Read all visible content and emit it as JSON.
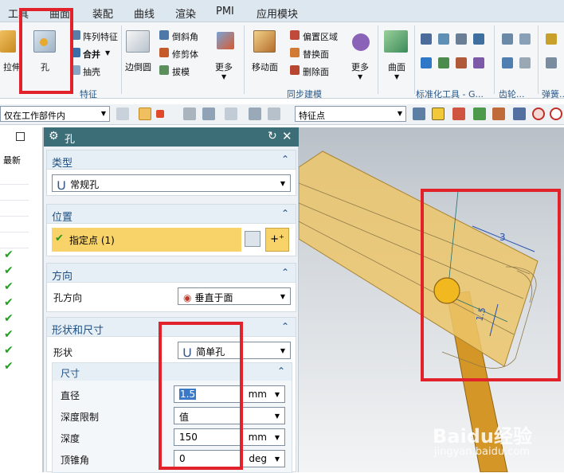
{
  "menu": [
    "工具",
    "曲面",
    "装配",
    "曲线",
    "渲染",
    "PMI",
    "应用模块"
  ],
  "ribbon": {
    "extrude": "拉伸",
    "hole": "孔",
    "pattern_feature": "阵列特征",
    "unite": "合并",
    "shell": "抽壳",
    "features_group": "特征",
    "edge_blend": "边倒圆",
    "chamfer": "倒斜角",
    "trim_body": "修剪体",
    "draft": "拔模",
    "more1": "更多",
    "move_face": "移动面",
    "offset_region": "偏置区域",
    "replace_face": "替换面",
    "delete_face": "删除面",
    "sync_group": "同步建模",
    "more2": "更多",
    "surface": "曲面",
    "std_tools_group": "标准化工具 - G...",
    "gear_group": "齿轮...",
    "spring_group": "弹簧..."
  },
  "toolbar": {
    "scope": "仅在工作部件内",
    "snap": "特征点"
  },
  "left_panel": {
    "header": "最新",
    "checks": [
      "✔",
      "✔",
      "✔",
      "✔",
      "✔",
      "✔",
      "✔",
      "✔"
    ]
  },
  "dialog": {
    "title": "孔",
    "type": {
      "header": "类型",
      "value": "常规孔"
    },
    "position": {
      "header": "位置",
      "specify_point": "指定点 (1)"
    },
    "direction": {
      "header": "方向",
      "label": "孔方向",
      "value": "垂直于面"
    },
    "form": {
      "header": "形状和尺寸",
      "shape_label": "形状",
      "shape_value": "简单孔",
      "dims_header": "尺寸",
      "diameter_label": "直径",
      "diameter_value": "1.5",
      "diameter_unit": "mm",
      "depth_limit_label": "深度限制",
      "depth_limit_value": "值",
      "depth_label": "深度",
      "depth_value": "150",
      "depth_unit": "mm",
      "tip_angle_label": "顶锥角",
      "tip_angle_value": "0",
      "tip_angle_unit": "deg"
    }
  },
  "viewport": {
    "dim_top": "3",
    "dim_side": "1.5"
  },
  "watermark": {
    "brand": "Baidu经验",
    "url": "jingyan.baidu.com"
  },
  "colors": {
    "accent": "#3c6e78",
    "highlight": "#f8d36a",
    "annotation": "#e2222a",
    "part": "#e2a93a"
  }
}
